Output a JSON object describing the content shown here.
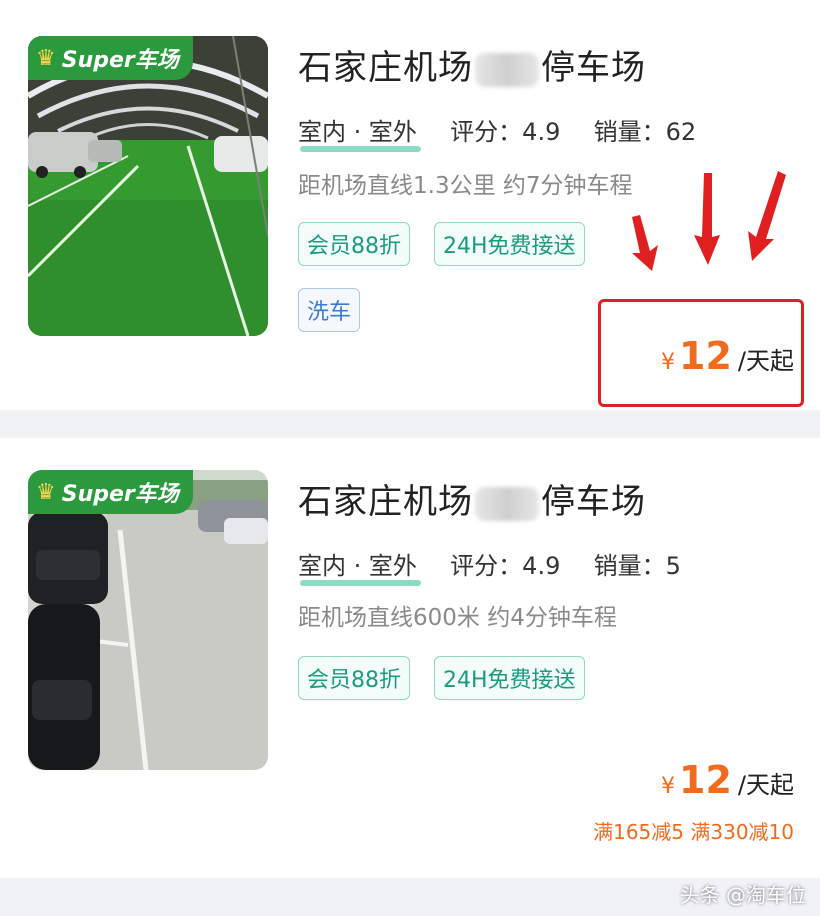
{
  "listings": [
    {
      "badge": "Super车场",
      "title_prefix": "石家庄机场",
      "title_suffix": "停车场",
      "type_label": "室内 · 室外",
      "rating_label": "评分：",
      "rating": "4.9",
      "sales_label": "销量：",
      "sales": "62",
      "distance": "距机场直线1.3公里 约7分钟车程",
      "tags": [
        "会员88折",
        "24H免费接送",
        "洗车"
      ],
      "price_symbol": "¥",
      "price": "12",
      "price_unit": "/天起"
    },
    {
      "badge": "Super车场",
      "title_prefix": "石家庄机场",
      "title_suffix": "停车场",
      "type_label": "室内 · 室外",
      "rating_label": "评分：",
      "rating": "4.9",
      "sales_label": "销量：",
      "sales": "5",
      "distance": "距机场直线600米 约4分钟车程",
      "tags": [
        "会员88折",
        "24H免费接送"
      ],
      "price_symbol": "¥",
      "price": "12",
      "price_unit": "/天起",
      "discounts": "满165减5 满330减10"
    }
  ],
  "watermark": "头条 @淘车位",
  "colors": {
    "price": "#f26b1d",
    "tag_green": "#1a9c7e",
    "tag_blue": "#3a7bd5",
    "badge_green": "#2b9a3e",
    "annotation_red": "#e02020"
  }
}
